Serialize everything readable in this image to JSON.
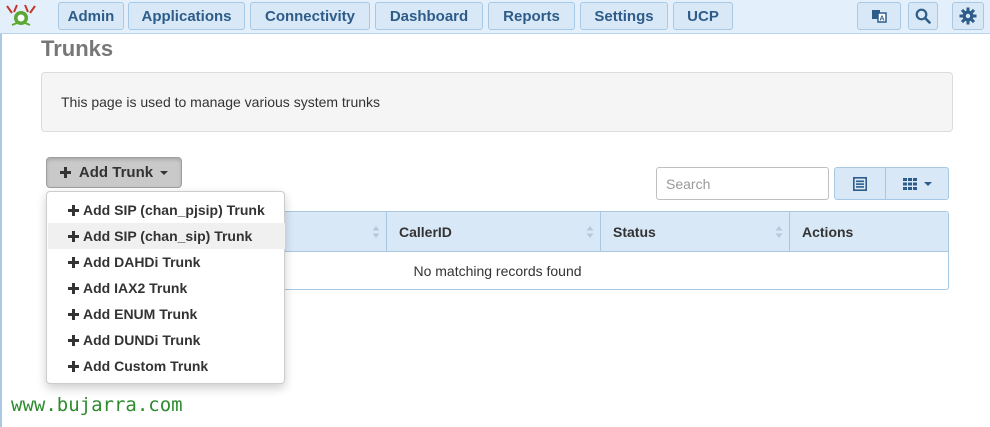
{
  "nav": {
    "items": [
      {
        "label": "Admin"
      },
      {
        "label": "Applications"
      },
      {
        "label": "Connectivity"
      },
      {
        "label": "Dashboard"
      },
      {
        "label": "Reports"
      },
      {
        "label": "Settings"
      },
      {
        "label": "UCP"
      }
    ],
    "icons": [
      "language-icon",
      "search-icon",
      "gear-icon"
    ]
  },
  "page": {
    "title": "Trunks",
    "description": "This page is used to manage various system trunks"
  },
  "toolbar": {
    "add_label": "Add Trunk",
    "search_placeholder": "Search"
  },
  "dropdown": {
    "items": [
      {
        "label": "Add SIP (chan_pjsip) Trunk"
      },
      {
        "label": "Add SIP (chan_sip) Trunk"
      },
      {
        "label": "Add DAHDi Trunk"
      },
      {
        "label": "Add IAX2 Trunk"
      },
      {
        "label": "Add ENUM Trunk"
      },
      {
        "label": "Add DUNDi Trunk"
      },
      {
        "label": "Add Custom Trunk"
      }
    ]
  },
  "table": {
    "columns": [
      "",
      "CallerID",
      "Status",
      "Actions"
    ],
    "empty_message": "No matching records found"
  },
  "watermark": "www.bujarra.com",
  "colors": {
    "nav_bg": "#e3f0fb",
    "nav_button": "#d8e8f6",
    "nav_text": "#2e5c8a",
    "watermark": "#2e8b2e"
  }
}
